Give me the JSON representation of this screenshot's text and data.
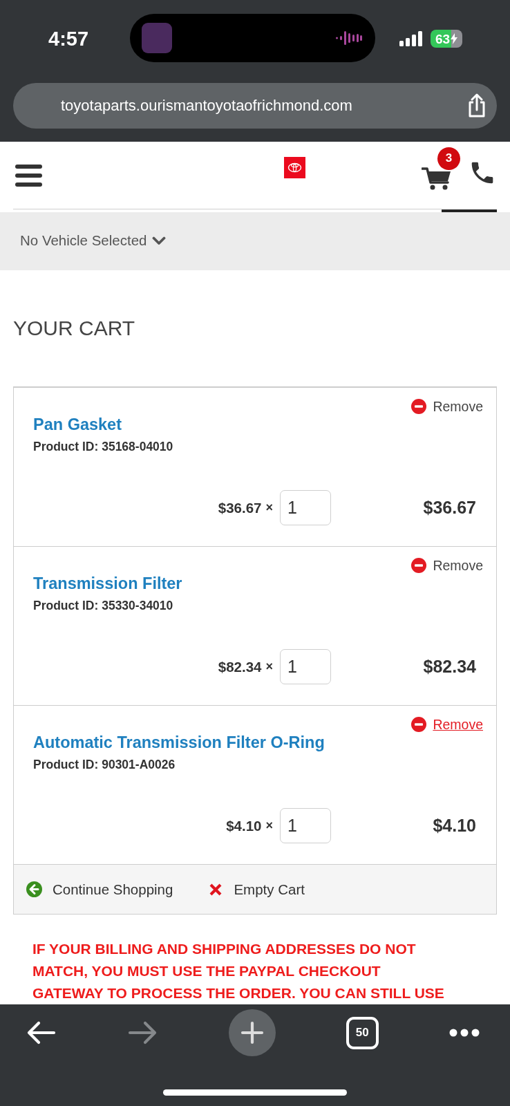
{
  "status_bar": {
    "time": "4:57",
    "battery": "63"
  },
  "browser": {
    "url": "toyotaparts.ourismantoyotaofrichmond.com"
  },
  "header": {
    "cart_count": "3"
  },
  "vehicle_selector": {
    "label": "No Vehicle Selected"
  },
  "page_title": "YOUR CART",
  "cart": {
    "items": [
      {
        "name": "Pan Gasket",
        "product_id": "Product ID: 35168-04010",
        "unit_price": "$36.67",
        "multiplier": "×",
        "quantity": "1",
        "total": "$36.67",
        "remove": {
          "label": "Remove",
          "focused": false
        }
      },
      {
        "name": "Transmission Filter",
        "product_id": "Product ID: 35330-34010",
        "unit_price": "$82.34",
        "multiplier": "×",
        "quantity": "1",
        "total": "$82.34",
        "remove": {
          "label": "Remove",
          "focused": false
        }
      },
      {
        "name": "Automatic Transmission Filter O-Ring",
        "product_id": "Product ID: 90301-A0026",
        "unit_price": "$4.10",
        "multiplier": "×",
        "quantity": "1",
        "total": "$4.10",
        "remove": {
          "label": "Remove",
          "focused": true
        }
      }
    ],
    "actions": [
      {
        "kind": "continue",
        "label": "Continue Shopping"
      },
      {
        "kind": "empty",
        "label": "Empty Cart"
      }
    ]
  },
  "notice": {
    "lines": [
      "IF YOUR BILLING AND SHIPPING ADDRESSES DO NOT",
      "MATCH, YOU MUST USE THE PAYPAL CHECKOUT",
      "GATEWAY TO PROCESS THE ORDER. YOU CAN STILL USE"
    ]
  },
  "toolbar": {
    "buttons": [
      {
        "kind": "back",
        "disabled": false
      },
      {
        "kind": "forward",
        "disabled": true
      },
      {
        "kind": "new_tab",
        "disabled": false
      },
      {
        "kind": "tabs",
        "label": "50",
        "disabled": false
      },
      {
        "kind": "more",
        "disabled": false
      }
    ]
  }
}
